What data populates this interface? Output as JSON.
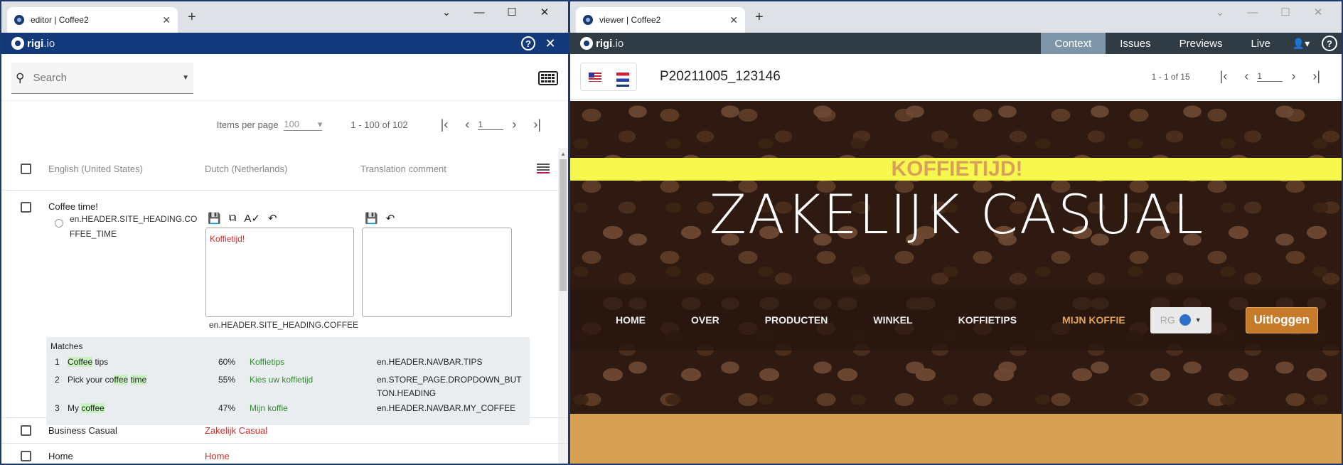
{
  "left": {
    "tab_title": "editor | Coffee2",
    "logo_text": "rigi",
    "logo_suffix": ".io",
    "search_placeholder": "Search",
    "pager": {
      "items_per_page_label": "Items per page",
      "items_per_page_value": "100",
      "range": "1 - 100 of 102",
      "page": "1"
    },
    "columns": {
      "source": "English (United States)",
      "target": "Dutch (Netherlands)",
      "comment": "Translation comment"
    },
    "row1": {
      "source": "Coffee time!",
      "key": "en.HEADER.SITE_HEADING.COFFEE_TIME",
      "target": "Koffietijd!",
      "target_key": "en.HEADER.SITE_HEADING.COFFEE"
    },
    "matches": {
      "title": "Matches",
      "items": [
        {
          "n": "1",
          "source_html": "<span class=\"hl\">Coffee</span> tips",
          "pct": "60%",
          "target": "Koffietips",
          "key": "en.HEADER.NAVBAR.TIPS"
        },
        {
          "n": "2",
          "source_html": "Pick your co<span class=\"hl\">ffee</span> <span class=\"hl\">time</span>",
          "pct": "55%",
          "target": "Kies uw koffietijd",
          "key": "en.STORE_PAGE.DROPDOWN_BUTTON.HEADING"
        },
        {
          "n": "3",
          "source_html": "My <span class=\"hl\">coffee</span>",
          "pct": "47%",
          "target": "Mijn koffie",
          "key": "en.HEADER.NAVBAR.MY_COFFEE"
        }
      ]
    },
    "rows": [
      {
        "source": "Business Casual",
        "target": "Zakelijk Casual"
      },
      {
        "source": "Home",
        "target": "Home"
      }
    ]
  },
  "right": {
    "tab_title": "viewer | Coffee2",
    "logo_text": "rigi",
    "logo_suffix": ".io",
    "nav": [
      "Context",
      "Issues",
      "Previews",
      "Live"
    ],
    "active_nav": "Context",
    "title": "P20211005_123146",
    "pager": {
      "range": "1 - 1 of 15",
      "page": "1"
    },
    "site": {
      "banner": "KOFFIETIJD!",
      "heading": "ZAKELIJK CASUAL",
      "menu": [
        "HOME",
        "OVER",
        "PRODUCTEN",
        "WINKEL",
        "KOFFIETIPS",
        "MIJN KOFFIE"
      ],
      "active_menu": "MIJN KOFFIE",
      "lang_select": "RG",
      "logout": "Uitloggen"
    }
  },
  "icons": {
    "close": "close-icon",
    "help": "help-icon",
    "search": "search-icon",
    "keyboard": "keyboard-icon",
    "save": "save-icon",
    "open": "open-external-icon",
    "spellcheck": "spellcheck-icon",
    "undo": "undo-icon",
    "user": "user-icon"
  }
}
